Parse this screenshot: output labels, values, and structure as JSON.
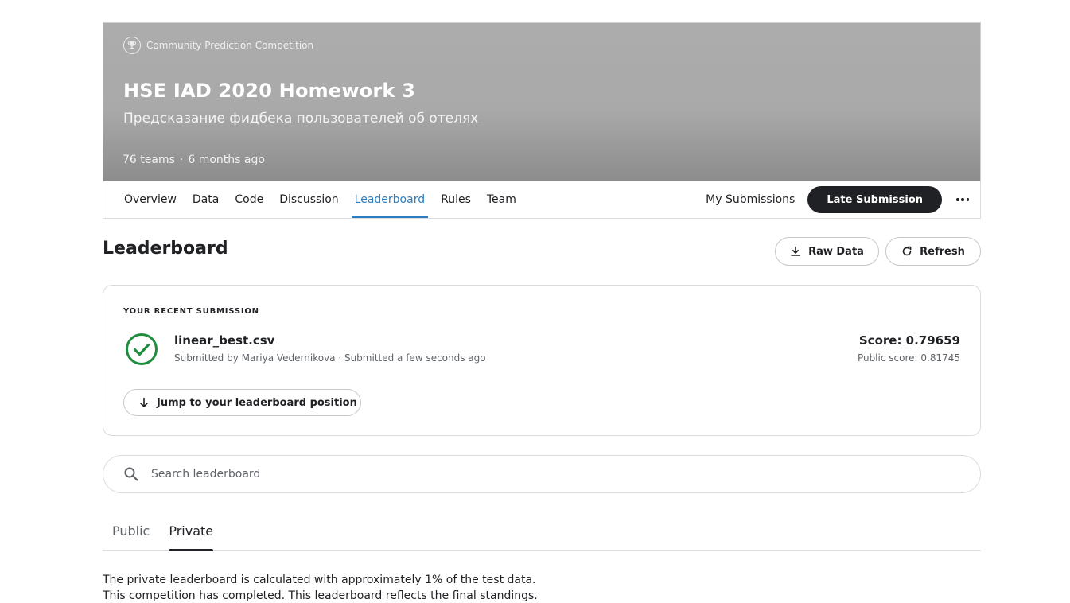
{
  "competition": {
    "kind_label": "Community Prediction Competition",
    "title": "HSE IAD 2020 Homework 3",
    "subtitle": "Предсказание фидбека пользователей об отелях",
    "teams": "76 teams",
    "separator": "·",
    "age": "6 months ago"
  },
  "nav": {
    "tabs": [
      {
        "label": "Overview"
      },
      {
        "label": "Data"
      },
      {
        "label": "Code"
      },
      {
        "label": "Discussion"
      },
      {
        "label": "Leaderboard",
        "active": true
      },
      {
        "label": "Rules"
      },
      {
        "label": "Team"
      }
    ],
    "my_submissions": "My Submissions",
    "late_submission": "Late Submission"
  },
  "leaderboard": {
    "title": "Leaderboard",
    "raw_data_label": "Raw Data",
    "refresh_label": "Refresh"
  },
  "recent_submission": {
    "section_label": "YOUR RECENT SUBMISSION",
    "filename": "linear_best.csv",
    "byline": "Submitted by Mariya Vedernikova · Submitted a few seconds ago",
    "score": "Score: 0.79659",
    "public_score": "Public score: 0.81745",
    "jump_label": "Jump to your leaderboard position",
    "status_color": "#1e8e3e"
  },
  "search": {
    "placeholder": "Search leaderboard",
    "value": ""
  },
  "visibility_tabs": [
    {
      "label": "Public",
      "active": false
    },
    {
      "label": "Private",
      "active": true
    }
  ],
  "notes": {
    "line1": "The private leaderboard is calculated with approximately 1% of the test data.",
    "line2": "This competition has completed. This leaderboard reflects the final standings."
  },
  "colors": {
    "accent": "#2d7fc1",
    "dark_button": "#202124"
  },
  "icons": {
    "kind": "trophy-icon",
    "raw_data": "download-icon",
    "refresh": "refresh-icon",
    "status": "check-circle-icon",
    "jump": "arrow-down-icon",
    "search": "search-icon",
    "more": "more-horizontal-icon"
  }
}
